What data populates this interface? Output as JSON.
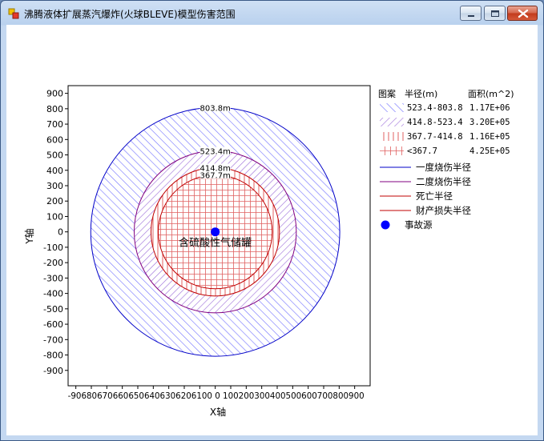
{
  "window": {
    "title": "沸腾液体扩展蒸汽爆炸(火球BLEVE)模型伤害范围"
  },
  "colors": {
    "ring_blue": "#0000c8",
    "ring_purple": "#800080",
    "ring_red": "#c00000",
    "hatch_blue": "#7070ff",
    "hatch_purple": "#9a6ad8",
    "hatch_red": "#e06060",
    "dot": "#0000ff"
  },
  "chart_data": {
    "type": "scatter",
    "xlabel": "X轴",
    "ylabel": "Y轴",
    "xlim": [
      -950,
      1000
    ],
    "ylim": [
      -1000,
      950
    ],
    "x_ticks": [
      -900,
      -800,
      -700,
      -600,
      -500,
      -400,
      -300,
      -200,
      -100,
      0,
      100,
      200,
      300,
      400,
      500,
      600,
      700,
      800,
      900
    ],
    "x_tick_labels": "-906806706606506406306206100 0 100200300400500600700800900",
    "y_ticks": [
      900,
      800,
      700,
      600,
      500,
      400,
      300,
      200,
      100,
      0,
      -100,
      -200,
      -300,
      -400,
      -500,
      -600,
      -700,
      -800,
      -900
    ],
    "grid": false,
    "rings": [
      {
        "radius": 803.8,
        "label": "803.8m",
        "color": "#0000c8",
        "pattern": "hatch-blue"
      },
      {
        "radius": 523.4,
        "label": "523.4m",
        "color": "#800080",
        "pattern": "hatch-purple"
      },
      {
        "radius": 414.8,
        "label": "414.8m",
        "color": "#c00000",
        "pattern": "vlines-red"
      },
      {
        "radius": 367.7,
        "label": "367.7m",
        "color": "#c00000",
        "pattern": "grid-red"
      }
    ],
    "source": {
      "x": 0,
      "y": 0,
      "label": "含硫酸性气储罐"
    },
    "legend": {
      "position": "right",
      "headers": [
        "图案",
        "半径(m)",
        "面积(m^2)"
      ],
      "zones": [
        {
          "range": "523.4-803.8",
          "area": "1.17E+06",
          "pattern": "hatch-blue"
        },
        {
          "range": "414.8-523.4",
          "area": "3.20E+05",
          "pattern": "hatch-purple"
        },
        {
          "range": "367.7-414.8",
          "area": "1.16E+05",
          "pattern": "vlines-red"
        },
        {
          "range": "<367.7",
          "area": "4.25E+05",
          "pattern": "grid-red"
        }
      ],
      "lines": [
        {
          "label": "一度烧伤半径",
          "color": "#0000c8"
        },
        {
          "label": "二度烧伤半径",
          "color": "#800080"
        },
        {
          "label": "死亡半径",
          "color": "#c00000"
        },
        {
          "label": "财产损失半径",
          "color": "#c00000"
        }
      ],
      "dot_label": "事故源"
    }
  }
}
